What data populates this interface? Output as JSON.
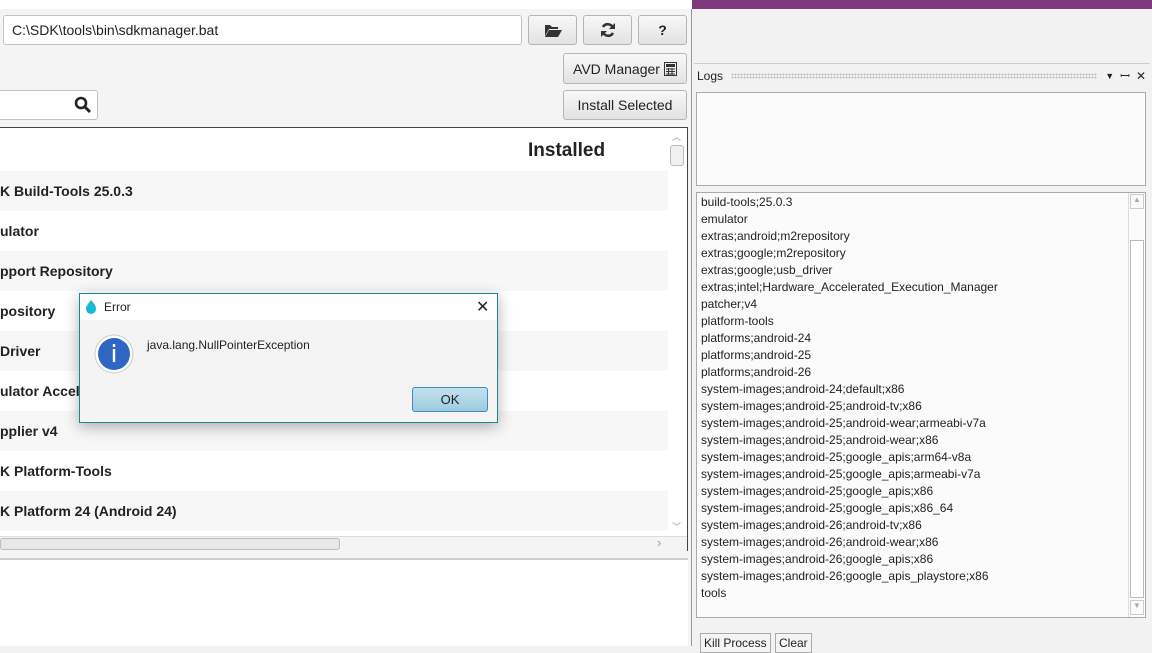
{
  "toolbar": {
    "path_value": "C:\\SDK\\tools\\bin\\sdkmanager.bat",
    "browse_icon": "folder-open-icon",
    "refresh_icon": "refresh-icon",
    "help_label": "?",
    "avd_manager_label": "AVD Manager",
    "avd_icon": "calculator-icon",
    "install_selected_label": "Install Selected",
    "search_value": "",
    "search_icon": "search-icon"
  },
  "table": {
    "header_installed": "Installed",
    "rows": [
      "K Build-Tools 25.0.3",
      "ulator",
      "pport Repository",
      "pository",
      "Driver",
      "ulator Accel",
      "pplier v4",
      "K Platform-Tools",
      "K Platform 24 (Android 24)"
    ]
  },
  "logs": {
    "title": "Logs",
    "lines": [
      "build-tools;25.0.3",
      "emulator",
      "extras;android;m2repository",
      "extras;google;m2repository",
      "extras;google;usb_driver",
      "extras;intel;Hardware_Accelerated_Execution_Manager",
      "patcher;v4",
      "platform-tools",
      "platforms;android-24",
      "platforms;android-25",
      "platforms;android-26",
      "system-images;android-24;default;x86",
      "system-images;android-25;android-tv;x86",
      "system-images;android-25;android-wear;armeabi-v7a",
      "system-images;android-25;android-wear;x86",
      "system-images;android-25;google_apis;arm64-v8a",
      "system-images;android-25;google_apis;armeabi-v7a",
      "system-images;android-25;google_apis;x86",
      "system-images;android-25;google_apis;x86_64",
      "system-images;android-26;android-tv;x86",
      "system-images;android-26;android-wear;x86",
      "system-images;android-26;google_apis;x86",
      "system-images;android-26;google_apis_playstore;x86",
      "tools"
    ],
    "kill_label": "Kill Process",
    "clear_label": "Clear"
  },
  "dialog": {
    "title": "Error",
    "message": "java.lang.NullPointerException",
    "ok_label": "OK",
    "icon": "info-icon"
  },
  "colors": {
    "accent_purple": "#7f3a7d",
    "dialog_border": "#178a8e",
    "info_blue": "#2f66c4"
  }
}
